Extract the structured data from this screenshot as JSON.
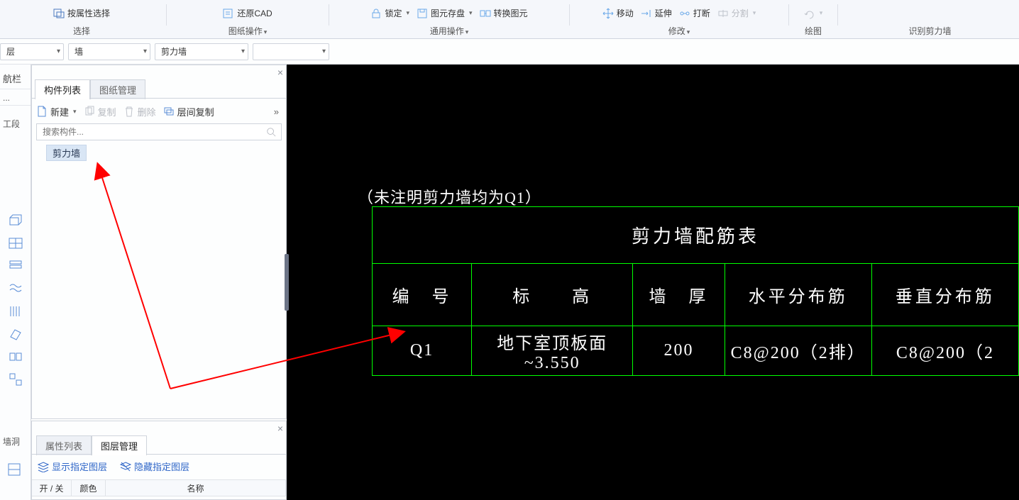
{
  "ribbon": {
    "select_group": {
      "btn_property_select": "按属性选择",
      "label": "选择"
    },
    "drawing_ops": {
      "btn_restore_cad": "还原CAD",
      "label": "图纸操作",
      "has_dropdown": true
    },
    "general_ops": {
      "btn_lock": "锁定",
      "btn_save_element": "图元存盘",
      "btn_convert_element": "转换图元",
      "label": "通用操作",
      "has_dropdown": true
    },
    "modify": {
      "btn_move": "移动",
      "btn_extend": "延伸",
      "btn_break": "打断",
      "btn_split": "分割",
      "label": "修改",
      "has_dropdown": true
    },
    "draw": {
      "label": "绘图"
    },
    "recognize": {
      "label": "识别剪力墙"
    }
  },
  "selectors": {
    "s1": "层",
    "s2": "墙",
    "s3": "剪力墙",
    "s4": ""
  },
  "outer_left": {
    "nav_title": "航栏",
    "stripe": "...",
    "seg": "工段",
    "hole": "墙洞"
  },
  "panel": {
    "tab_components": "构件列表",
    "tab_drawing_manage": "图纸管理",
    "btn_new": "新建",
    "btn_copy": "复制",
    "btn_delete": "删除",
    "btn_floor_copy": "层间复制",
    "more": "»",
    "search_placeholder": "搜索构件...",
    "tree_item": "剪力墙"
  },
  "panel2": {
    "tab_props": "属性列表",
    "tab_layer": "图层管理",
    "link_show": "显示指定图层",
    "link_hide": "隐藏指定图层",
    "col_onoff": "开 / 关",
    "col_color": "颜色",
    "col_name": "名称"
  },
  "cad": {
    "note": "（未注明剪力墙均为Q1）",
    "table_title": "剪力墙配筋表",
    "headers": {
      "a": "编　号",
      "b": "标　　高",
      "c": "墙　厚",
      "d": "水平分布筋",
      "e": "垂直分布筋"
    },
    "row": {
      "a": "Q1",
      "b": "地下室顶板面~3.550",
      "c": "200",
      "d": "C8@200（2排）",
      "e": "C8@200（2"
    }
  }
}
